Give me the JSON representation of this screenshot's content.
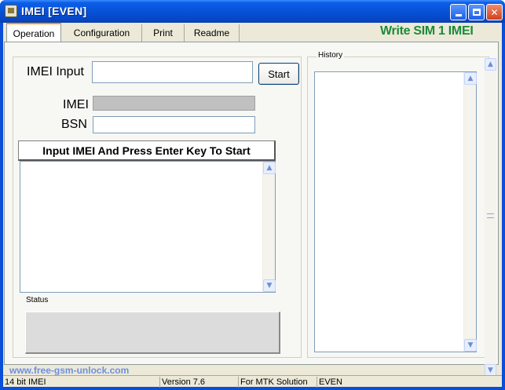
{
  "window": {
    "title": "IMEI  [EVEN]",
    "controls": [
      "minimize",
      "maximize",
      "close"
    ]
  },
  "tabs": [
    {
      "label": "Operation",
      "active": true
    },
    {
      "label": "Configuration",
      "active": false
    },
    {
      "label": "Print",
      "active": false
    },
    {
      "label": "Readme",
      "active": false
    }
  ],
  "mode_label": "Write SIM 1 IMEI",
  "operation": {
    "imei_input_label": "IMEI Input",
    "imei_input_value": "",
    "start_button": "Start",
    "imei_label": "IMEI",
    "imei_value": "",
    "bsn_label": "BSN",
    "bsn_value": "",
    "prompt": "Input IMEI And Press Enter Key To Start",
    "log_text": "",
    "status_label": "Status",
    "status_text": ""
  },
  "history": {
    "title": "History",
    "text": ""
  },
  "footer_link": "www.free-gsm-unlock.com",
  "statusbar": [
    "14 bit IMEI",
    "Version 7.6",
    "For MTK Solution",
    "EVEN"
  ],
  "colors": {
    "titlebar": "#0650d6",
    "accent_green": "#1b8a3a",
    "tab_highlight": "#ff9a00",
    "link": "#6e8fe0",
    "dialog_bg": "#ece9d8"
  }
}
